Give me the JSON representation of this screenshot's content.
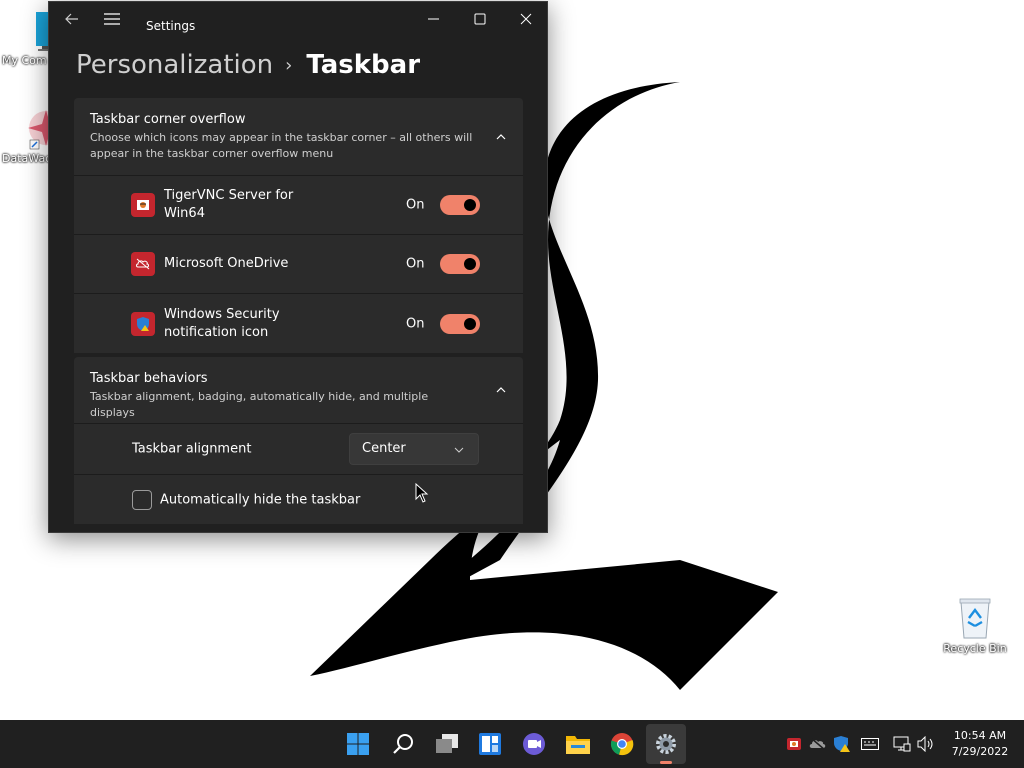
{
  "desktop": {
    "icons": [
      {
        "label": "My Com",
        "icon": "monitor-icon"
      },
      {
        "label": "DataWac",
        "icon": "datawac-icon"
      },
      {
        "label": "Recycle Bin",
        "icon": "recycle-bin-icon"
      }
    ]
  },
  "window": {
    "app_title": "Settings",
    "breadcrumb": {
      "parent": "Personalization",
      "separator": "›",
      "current": "Taskbar"
    },
    "controls": {
      "minimize": "minimize-icon",
      "maximize": "maximize-icon",
      "close": "close-icon"
    }
  },
  "corner_overflow": {
    "title": "Taskbar corner overflow",
    "description": "Choose which icons may appear in the taskbar corner – all others will appear in the taskbar corner overflow menu",
    "items": [
      {
        "name": "TigerVNC Server for Win64",
        "state": "On",
        "enabled": true,
        "icon": "tigervnc-icon"
      },
      {
        "name": "Microsoft OneDrive",
        "state": "On",
        "enabled": true,
        "icon": "onedrive-icon"
      },
      {
        "name": "Windows Security notification icon",
        "state": "On",
        "enabled": true,
        "icon": "windows-security-icon"
      }
    ]
  },
  "behaviors": {
    "title": "Taskbar behaviors",
    "description": "Taskbar alignment, badging, automatically hide, and multiple displays",
    "alignment_label": "Taskbar alignment",
    "alignment_value": "Center",
    "autohide_label": "Automatically hide the taskbar",
    "autohide_checked": false
  },
  "taskbar": {
    "apps": [
      "start-icon",
      "search-icon",
      "task-view-icon",
      "widgets-icon",
      "chat-icon",
      "file-explorer-icon",
      "chrome-icon",
      "settings-icon"
    ],
    "active_app": "settings-icon",
    "tray": [
      "tigervnc-tray-icon",
      "onedrive-tray-icon",
      "security-tray-icon",
      "keyboard-icon",
      "network-icon",
      "volume-icon"
    ],
    "time": "10:54 AM",
    "date": "7/29/2022"
  },
  "colors": {
    "accent": "#f0826a",
    "window_bg": "#202020",
    "card_bg": "#2b2b2b",
    "taskbar_bg": "#202020"
  }
}
